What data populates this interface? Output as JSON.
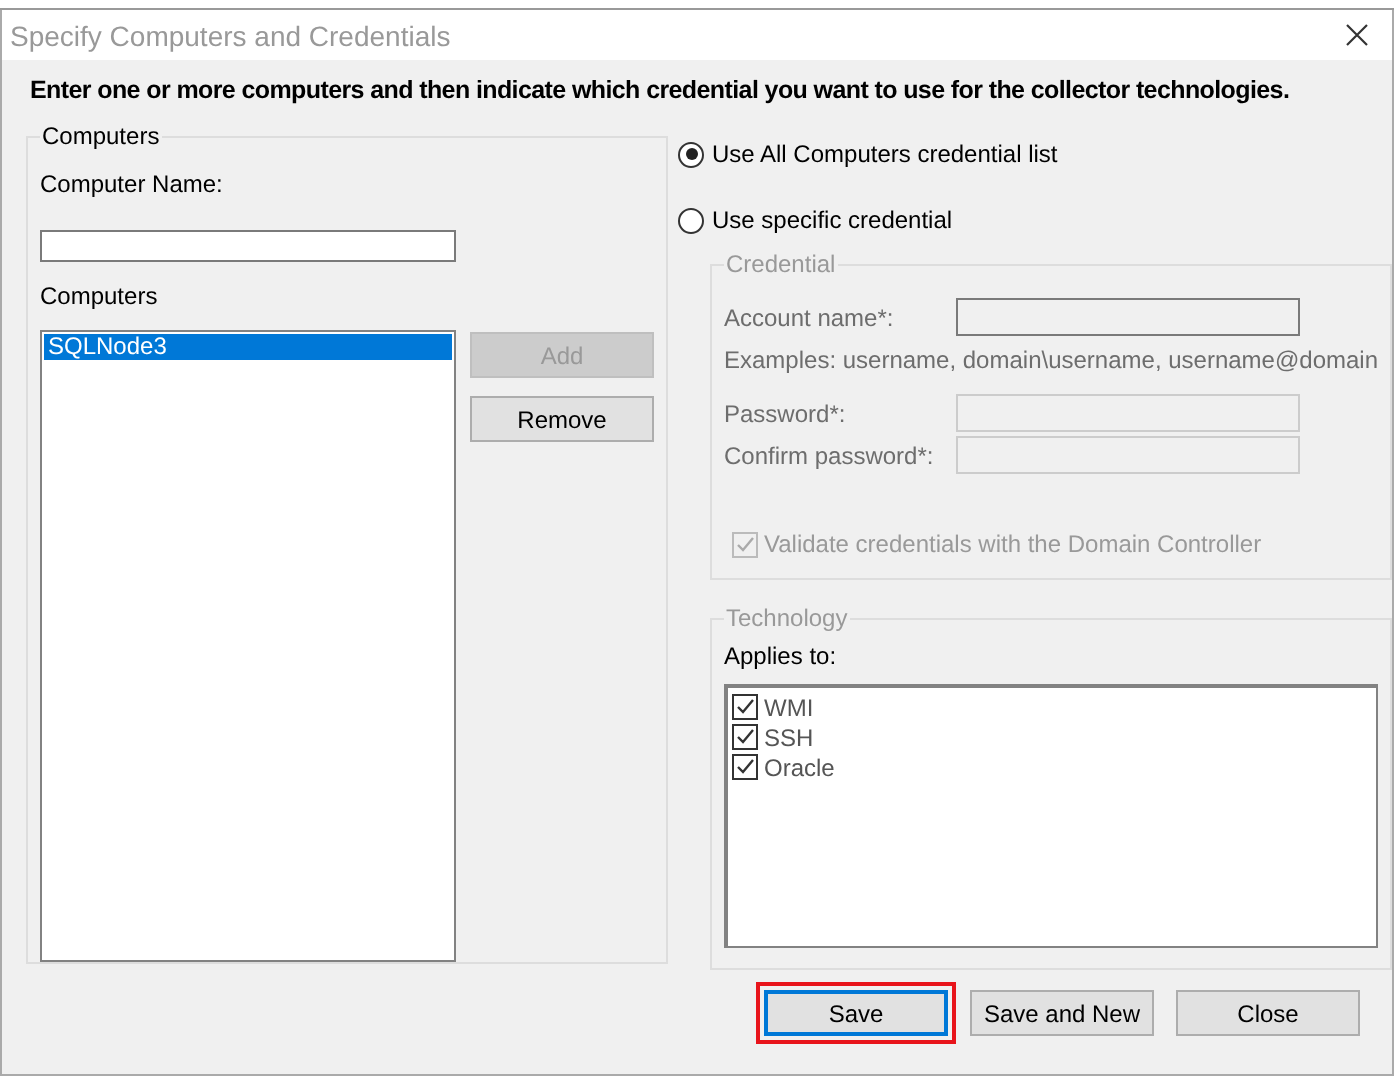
{
  "window": {
    "title": "Specify Computers and Credentials"
  },
  "instruction": "Enter one or more computers and then indicate which credential you want to use for the collector technologies.",
  "computers_group": {
    "title": "Computers",
    "name_label": "Computer Name:",
    "list_label": "Computers",
    "items": [
      {
        "label": "SQLNode3",
        "selected": true
      }
    ],
    "buttons": [
      {
        "label": "Add",
        "disabled": true
      },
      {
        "label": "Remove",
        "disabled": false
      }
    ]
  },
  "credential_options": [
    {
      "label": "Use All Computers credential list",
      "selected": true
    },
    {
      "label": "Use specific credential",
      "selected": false
    }
  ],
  "credential_group": {
    "title": "Credential",
    "disabled": true,
    "account_label": "Account name*:",
    "examples": "Examples: username, domain\\username, username@domain",
    "password_label": "Password*:",
    "confirm_label": "Confirm password*:",
    "validate": {
      "label": "Validate credentials with the Domain Controller",
      "checked": true
    }
  },
  "technology_group": {
    "title": "Technology",
    "applies_label": "Applies to:",
    "items": [
      {
        "label": "WMI",
        "checked": true
      },
      {
        "label": "SSH",
        "checked": true
      },
      {
        "label": "Oracle",
        "checked": true
      }
    ]
  },
  "buttons": [
    {
      "label": "Save",
      "focused": true,
      "highlighted": true
    },
    {
      "label": "Save and New",
      "focused": false,
      "highlighted": false
    },
    {
      "label": "Close",
      "focused": false,
      "highlighted": false
    }
  ]
}
